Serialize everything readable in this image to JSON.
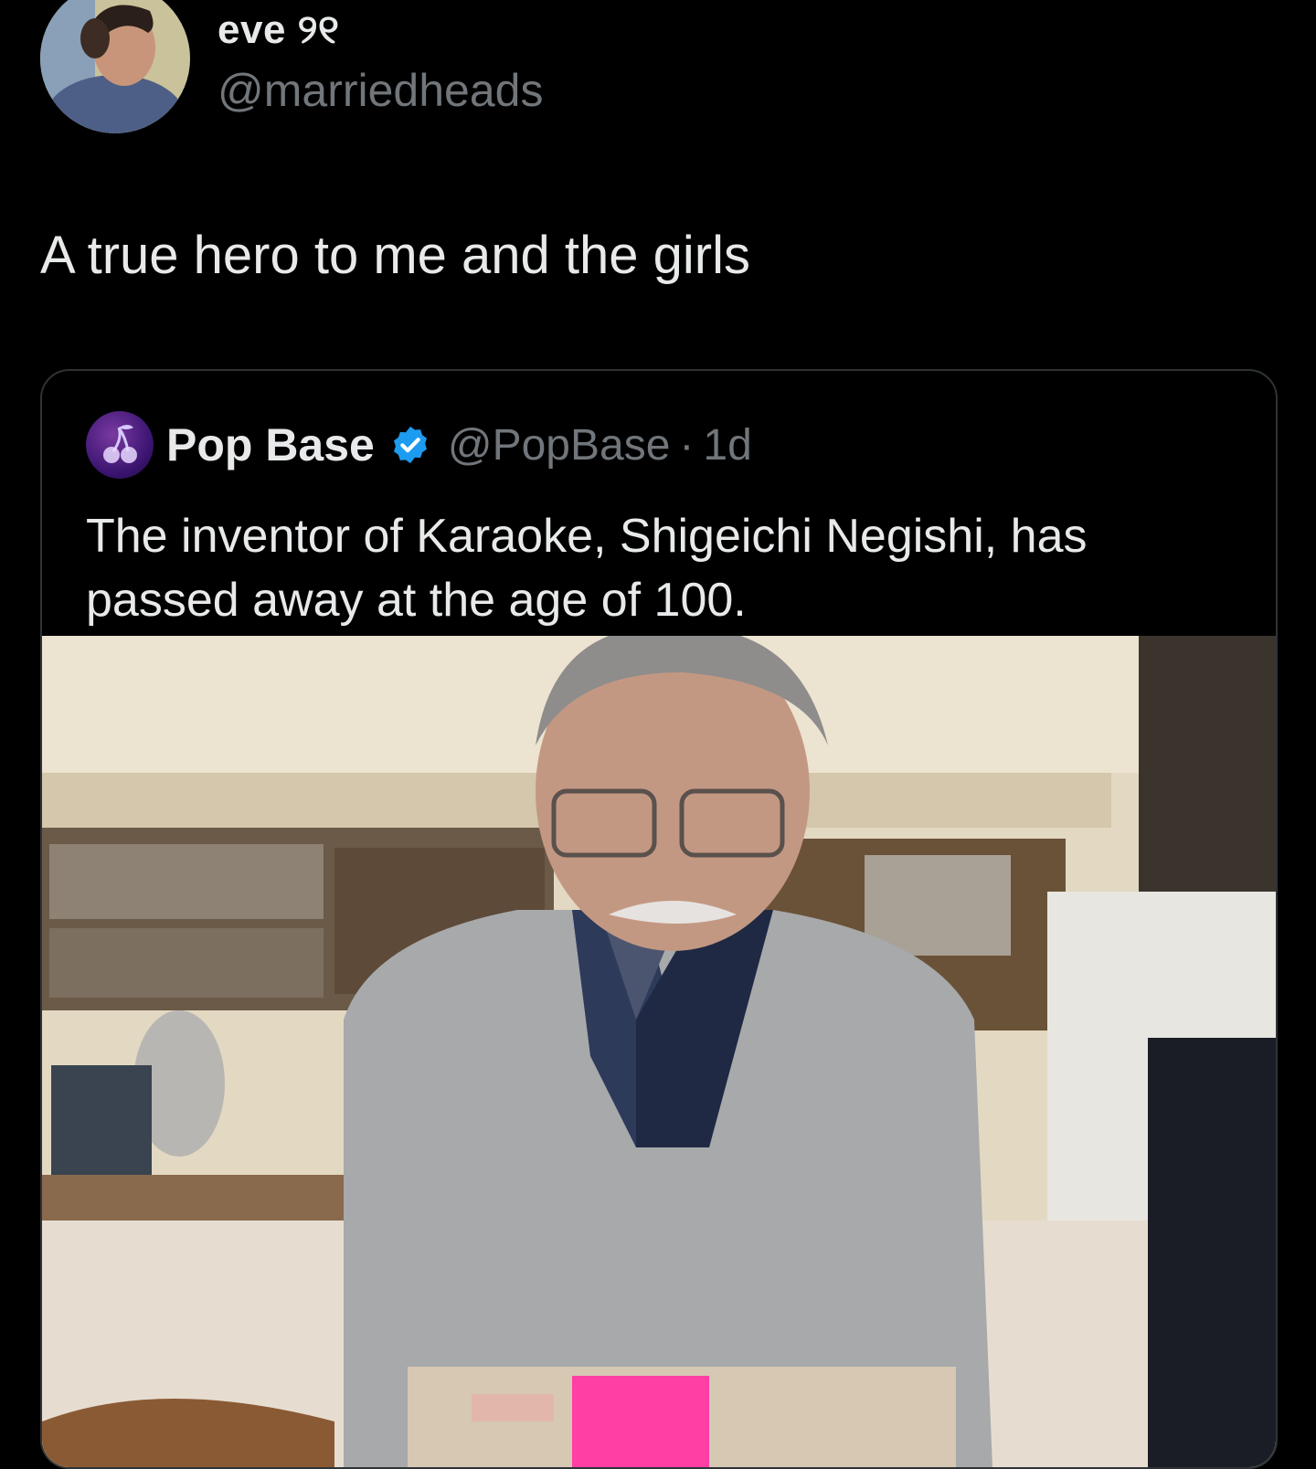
{
  "post": {
    "display_name": "eve ୨୧",
    "handle": "@marriedheads",
    "avatar_icon": "user-avatar-photo",
    "text": "A true hero to me and the girls"
  },
  "quoted_post": {
    "avatar_icon": "cherry-logo-avatar",
    "display_name": "Pop Base",
    "verified_icon": "verified-badge-icon",
    "verified_color": "#1d9bf0",
    "handle": "@PopBase",
    "separator": "·",
    "time": "1d",
    "text": "The inventor of Karaoke, Shigeichi Negishi, has passed away at the age of 100.",
    "media_icon": "photo-elderly-man-with-karaoke-machine"
  },
  "colors": {
    "background": "#000000",
    "primary_text": "#e7e9ea",
    "secondary_text": "#71767b",
    "border": "#2f3336"
  }
}
